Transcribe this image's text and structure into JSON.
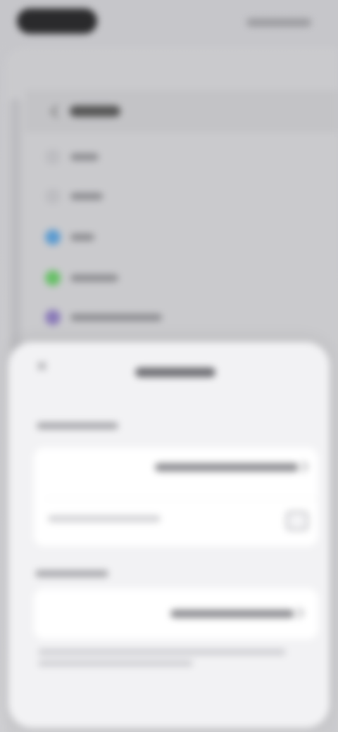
{
  "theme": {
    "background": "#c9c9cc",
    "sheet_background": "#f2f2f4",
    "group_background": "#ffffff",
    "accent_blue": "#5b9bd0",
    "accent_green": "#67c067",
    "accent_purple": "#8a7ab8"
  },
  "back_screen": {
    "rows": [
      {
        "icon": "generic-icon"
      },
      {
        "icon": "generic-icon"
      },
      {
        "icon": "blue-circle-icon"
      },
      {
        "icon": "green-circle-icon"
      },
      {
        "icon": "purple-circle-icon"
      }
    ]
  },
  "sheet": {
    "close_icon": "close-icon",
    "row_chevron_icon": "chevron-right-icon"
  }
}
